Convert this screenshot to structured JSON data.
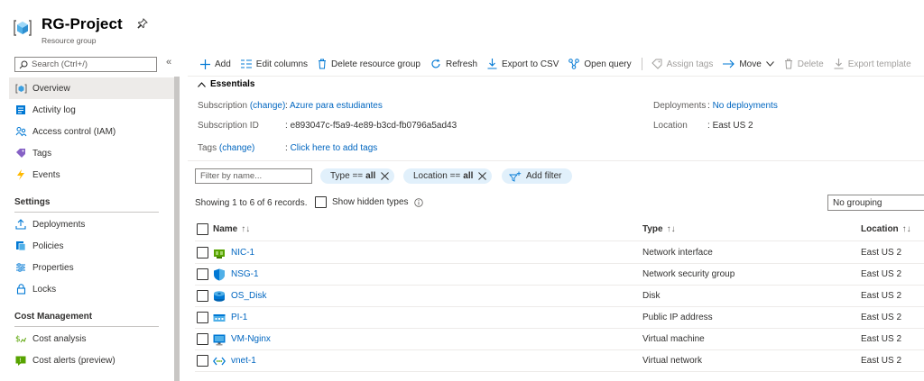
{
  "header": {
    "title": "RG-Project",
    "subtitle": "Resource group"
  },
  "sidebar": {
    "search_placeholder": "Search (Ctrl+/)",
    "collapse_glyph": "«",
    "items_top": [
      {
        "label": "Overview",
        "icon": "resource-group-icon"
      },
      {
        "label": "Activity log",
        "icon": "activity-log-icon"
      },
      {
        "label": "Access control (IAM)",
        "icon": "people-icon"
      },
      {
        "label": "Tags",
        "icon": "tag-icon"
      },
      {
        "label": "Events",
        "icon": "lightning-icon"
      }
    ],
    "settings_header": "Settings",
    "settings_items": [
      {
        "label": "Deployments",
        "icon": "upload-icon"
      },
      {
        "label": "Policies",
        "icon": "policy-icon"
      },
      {
        "label": "Properties",
        "icon": "properties-icon"
      },
      {
        "label": "Locks",
        "icon": "lock-icon"
      }
    ],
    "cost_header": "Cost Management",
    "cost_items": [
      {
        "label": "Cost analysis",
        "icon": "cost-analysis-icon"
      },
      {
        "label": "Cost alerts (preview)",
        "icon": "cost-alert-icon"
      }
    ]
  },
  "toolbar": {
    "add": "Add",
    "edit_columns": "Edit columns",
    "delete_group": "Delete resource group",
    "refresh": "Refresh",
    "export_csv": "Export to CSV",
    "open_query": "Open query",
    "assign_tags": "Assign tags",
    "move": "Move",
    "delete": "Delete",
    "export_template": "Export template"
  },
  "essentials": {
    "header": "Essentials",
    "subscription_label": "Subscription",
    "change": "(change)",
    "subscription_value": "Azure para estudiantes",
    "subscription_id_label": "Subscription ID",
    "subscription_id_value": "e893047c-f5a9-4e89-b3cd-fb0796a5ad43",
    "tags_label": "Tags",
    "tags_value": "Click here to add tags",
    "deployments_label": "Deployments",
    "deployments_value": "No deployments",
    "location_label": "Location",
    "location_value": "East US 2"
  },
  "filters": {
    "filter_placeholder": "Filter by name...",
    "type_pill_label": "Type ==",
    "type_pill_value": "all",
    "location_pill_label": "Location ==",
    "location_pill_value": "all",
    "add_filter": "Add filter"
  },
  "list": {
    "records": "Showing 1 to 6 of 6 records.",
    "show_hidden": "Show hidden types",
    "grouping": "No grouping",
    "columns": {
      "name": "Name",
      "type": "Type",
      "location": "Location"
    },
    "rows": [
      {
        "name": "NIC-1",
        "type": "Network interface",
        "location": "East US 2",
        "icon": "network-interface-icon"
      },
      {
        "name": "NSG-1",
        "type": "Network security group",
        "location": "East US 2",
        "icon": "shield-icon"
      },
      {
        "name": "OS_Disk",
        "type": "Disk",
        "location": "East US 2",
        "icon": "disk-icon"
      },
      {
        "name": "PI-1",
        "type": "Public IP address",
        "location": "East US 2",
        "icon": "public-ip-icon"
      },
      {
        "name": "VM-Nginx",
        "type": "Virtual machine",
        "location": "East US 2",
        "icon": "virtual-machine-icon"
      },
      {
        "name": "vnet-1",
        "type": "Virtual network",
        "location": "East US 2",
        "icon": "virtual-network-icon"
      }
    ]
  },
  "colors": {
    "link": "#0066c0",
    "pill_bg": "#e1f0fb",
    "active_nav": "#edebe9"
  }
}
